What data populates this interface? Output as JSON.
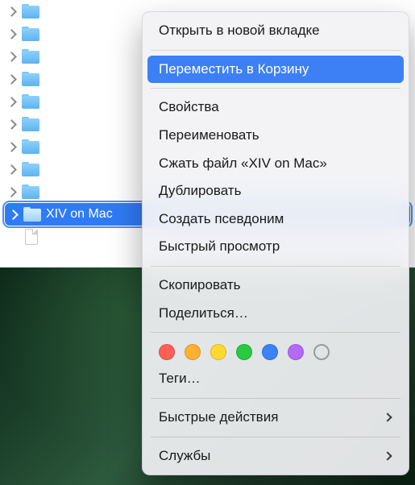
{
  "sidebar": {
    "rows": [
      {
        "label": ""
      },
      {
        "label": ""
      },
      {
        "label": ""
      },
      {
        "label": ""
      },
      {
        "label": ""
      },
      {
        "label": ""
      },
      {
        "label": ""
      },
      {
        "label": ""
      },
      {
        "label": ""
      }
    ],
    "selected": {
      "label": "XIV on Mac"
    }
  },
  "context_menu": {
    "open_new_tab": "Открыть в новой вкладке",
    "move_to_trash": "Переместить в Корзину",
    "get_info": "Свойства",
    "rename": "Переименовать",
    "compress": "Сжать файл «XIV on Mac»",
    "duplicate": "Дублировать",
    "make_alias": "Создать псевдоним",
    "quick_look": "Быстрый просмотр",
    "copy": "Скопировать",
    "share": "Поделиться…",
    "tags_label": "Теги…",
    "quick_actions": "Быстрые действия",
    "services": "Службы",
    "tag_colors": [
      "#ff5f57",
      "#ffb02e",
      "#ffd931",
      "#29c940",
      "#3b82f6",
      "#b569f7"
    ]
  }
}
